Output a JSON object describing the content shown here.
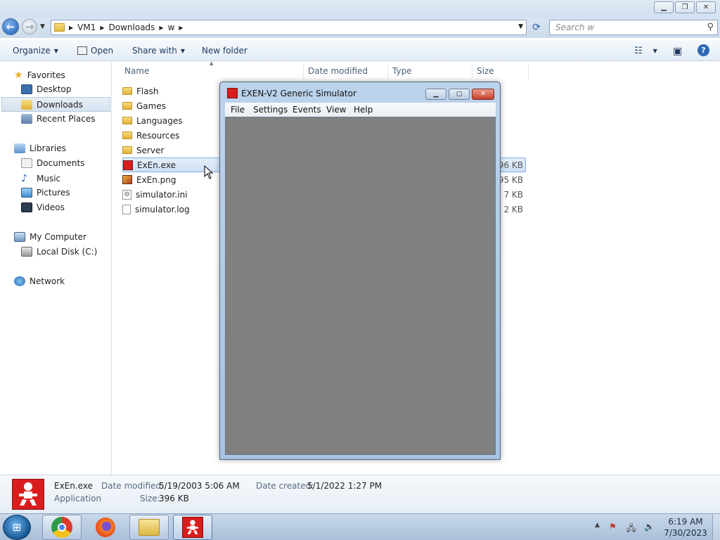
{
  "explorer": {
    "breadcrumb": [
      "VM1",
      "Downloads",
      "w"
    ],
    "search_placeholder": "Search w",
    "toolbar": {
      "organize": "Organize",
      "open": "Open",
      "share_with": "Share with",
      "new_folder": "New folder"
    },
    "nav": {
      "favorites": "Favorites",
      "desktop": "Desktop",
      "downloads": "Downloads",
      "recent": "Recent Places",
      "libraries": "Libraries",
      "documents": "Documents",
      "music": "Music",
      "pictures": "Pictures",
      "videos": "Videos",
      "computer": "My Computer",
      "localdisk": "Local Disk (C:)",
      "network": "Network"
    },
    "columns": {
      "name": "Name",
      "date_modified": "Date modified",
      "type": "Type",
      "size": "Size"
    },
    "files": [
      {
        "name": "Flash",
        "size": ""
      },
      {
        "name": "Games",
        "size": ""
      },
      {
        "name": "Languages",
        "size": ""
      },
      {
        "name": "Resources",
        "size": ""
      },
      {
        "name": "Server",
        "size": ""
      },
      {
        "name": "ExEn.exe",
        "size": "396 KB"
      },
      {
        "name": "ExEn.png",
        "size": "95 KB"
      },
      {
        "name": "simulator.ini",
        "size": "7 KB"
      },
      {
        "name": "simulator.log",
        "size": "2 KB"
      }
    ],
    "details": {
      "name": "ExEn.exe",
      "type": "Application",
      "date_modified_label": "Date modified:",
      "date_modified": "5/19/2003 5:06 AM",
      "date_created_label": "Date created:",
      "date_created": "5/1/2022 1:27 PM",
      "size_label": "Size:",
      "size": "396 KB"
    }
  },
  "simulator": {
    "title": "EXEN-V2 Generic Simulator",
    "menu": [
      "File",
      "Settings",
      "Events",
      "View",
      "Help"
    ]
  },
  "taskbar": {
    "time": "6:19 AM",
    "date": "7/30/2023"
  }
}
